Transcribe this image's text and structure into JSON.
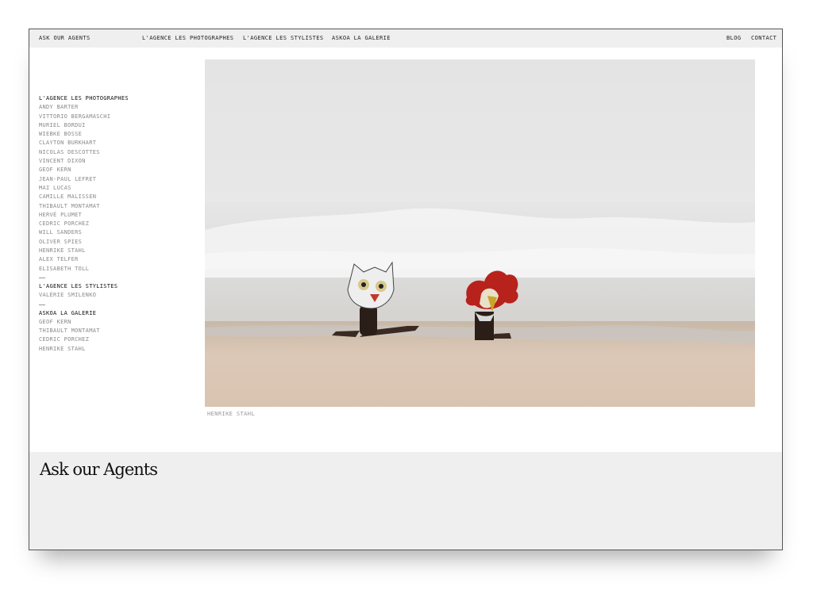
{
  "nav": {
    "brand": "ASK OUR AGENTS",
    "links": [
      "L'AGENCE LES PHOTOGRAPHES",
      "L'AGENCE LES STYLISTES",
      "ASKOA LA GALERIE"
    ],
    "right_links": [
      "BLOG",
      "CONTACT"
    ]
  },
  "sidebar": {
    "photographes_title": "L'AGENCE LES PHOTOGRAPHES",
    "photographes": [
      "ANDY BARTER",
      "VITTORIO BERGAMASCHI",
      "MURIEL BORDUI",
      "WIEBKE BOSSE",
      "CLAYTON BURKHART",
      "NICOLAS DESCOTTES",
      "VINCENT DIXON",
      "GEOF KERN",
      "JEAN-PAUL LEFRET",
      "MAI LUCAS",
      "CAMILLE MALISSEN",
      "THIBAULT MONTAMAT",
      "HERVÉ PLUMET",
      "CEDRIC PORCHEZ",
      "WILL SANDERS",
      "OLIVER SPIES",
      "HENRIKE STAHL",
      "ALEX TELFER",
      "ELISABETH TOLL"
    ],
    "stylistes_title": "L'AGENCE LES STYLISTES",
    "stylistes": [
      "VALÉRIE SMILENKO"
    ],
    "galerie_title": "ASKOA LA GALERIE",
    "galerie": [
      "GEOF KERN",
      "THIBAULT MONTAMAT",
      "CEDRIC PORCHEZ",
      "HENRIKE STAHL"
    ]
  },
  "main": {
    "caption": "HENRIKE STAHL"
  },
  "footer": {
    "logo": "Ask our Agents"
  }
}
